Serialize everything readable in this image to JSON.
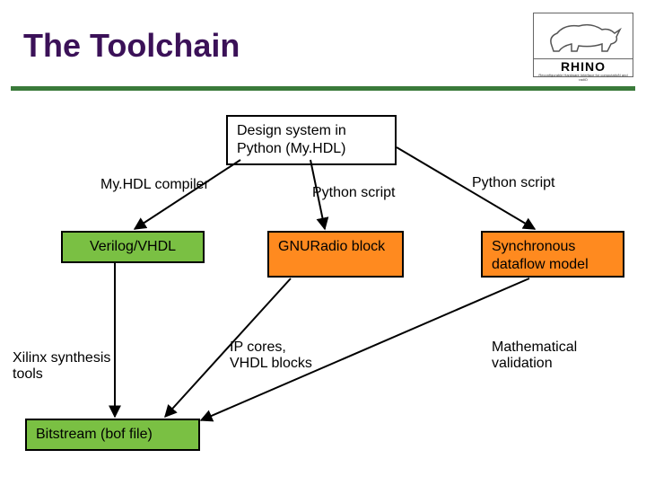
{
  "title": "The Toolchain",
  "logo": {
    "brand": "RHINO",
    "tagline": "Reconfigurable Hardware Interface for computatioN and radiO"
  },
  "nodes": {
    "design": "Design system in Python (My.HDL)",
    "verilog": "Verilog/VHDL",
    "gnuradio": "GNURadio block",
    "sdf": "Synchronous dataflow model",
    "bitstream": "Bitstream (bof file)"
  },
  "edges": {
    "myhdl_compiler": "My.HDL compiler",
    "python_script_mid": "Python script",
    "python_script_right": "Python script",
    "ip_cores": "IP cores,\nVHDL blocks",
    "xilinx": "Xilinx synthesis tools",
    "math_valid": "Mathematical validation"
  }
}
